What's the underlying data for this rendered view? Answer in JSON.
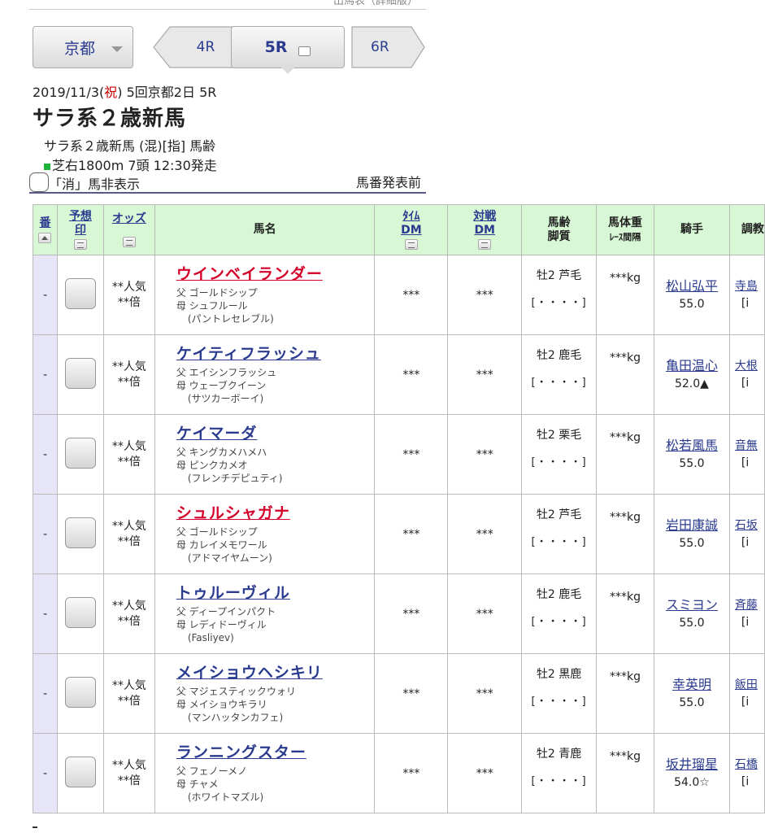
{
  "top_link": "出馬表（詳細版）",
  "nav": {
    "venue": "京都",
    "prev": "4R",
    "current": "5R",
    "next": "6R"
  },
  "race": {
    "date_pre": "2019/11/3(",
    "holiday": "祝",
    "date_post": ") 5回京都2日 5R",
    "title": "サラ系２歳新馬",
    "conditions": "サラ系２歳新馬 (混)[指] 馬齢",
    "course": "芝右1800m 7頭 12:30発走"
  },
  "filter": {
    "label": "「消」馬非表示",
    "status": "馬番発表前"
  },
  "headers": {
    "ban": "番",
    "yoso_1": "予想",
    "yoso_2": "印",
    "odds": "オッズ",
    "name": "馬名",
    "time_1": "ﾀｲﾑ",
    "time_2": "DM",
    "taisen_1": "対戦",
    "taisen_2": "DM",
    "age_1": "馬齢",
    "age_2": "脚質",
    "wt_1": "馬体重",
    "wt_2": "ﾚｰｽ間隔",
    "jockey": "騎手",
    "trainer": "調教"
  },
  "horses": [
    {
      "num": "-",
      "pop": "**人気",
      "odds": "**倍",
      "name": "ウインベイランダー",
      "red": true,
      "sire": "父 ゴールドシップ",
      "dam": "母 シュフルール",
      "bms": "(パントレセレブル)",
      "time_dm": "***",
      "taisen_dm": "***",
      "age": "牡2 芦毛",
      "legs": "[・・・・]",
      "weight": "***kg",
      "jockey": "松山弘平",
      "kin": "55.0",
      "trainer": "寺島",
      "trainer_sub": "[i"
    },
    {
      "num": "-",
      "pop": "**人気",
      "odds": "**倍",
      "name": "ケイティフラッシュ",
      "red": false,
      "sire": "父 エイシンフラッシュ",
      "dam": "母 ウェーブクイーン",
      "bms": "(サツカーボーイ)",
      "time_dm": "***",
      "taisen_dm": "***",
      "age": "牡2 鹿毛",
      "legs": "[・・・・]",
      "weight": "***kg",
      "jockey": "亀田温心",
      "kin": "52.0▲",
      "trainer": "大根",
      "trainer_sub": "[i"
    },
    {
      "num": "-",
      "pop": "**人気",
      "odds": "**倍",
      "name": "ケイマーダ",
      "red": false,
      "sire": "父 キングカメハメハ",
      "dam": "母 ピンクカメオ",
      "bms": "(フレンチデピュティ)",
      "time_dm": "***",
      "taisen_dm": "***",
      "age": "牡2 栗毛",
      "legs": "[・・・・]",
      "weight": "***kg",
      "jockey": "松若風馬",
      "kin": "55.0",
      "trainer": "音無",
      "trainer_sub": "[i"
    },
    {
      "num": "-",
      "pop": "**人気",
      "odds": "**倍",
      "name": "シュルシャガナ",
      "red": true,
      "sire": "父 ゴールドシップ",
      "dam": "母 カレイメモワール",
      "bms": "(アドマイヤムーン)",
      "time_dm": "***",
      "taisen_dm": "***",
      "age": "牡2 芦毛",
      "legs": "[・・・・]",
      "weight": "***kg",
      "jockey": "岩田康誠",
      "kin": "55.0",
      "trainer": "石坂",
      "trainer_sub": "[i"
    },
    {
      "num": "-",
      "pop": "**人気",
      "odds": "**倍",
      "name": "トゥルーヴィル",
      "red": false,
      "sire": "父 ディープインパクト",
      "dam": "母 レディドーヴィル",
      "bms": "(Fasliyev)",
      "time_dm": "***",
      "taisen_dm": "***",
      "age": "牡2 鹿毛",
      "legs": "[・・・・]",
      "weight": "***kg",
      "jockey": "スミヨン",
      "kin": "55.0",
      "trainer": "斉藤",
      "trainer_sub": "[i"
    },
    {
      "num": "-",
      "pop": "**人気",
      "odds": "**倍",
      "name": "メイショウヘシキリ",
      "red": false,
      "sire": "父 マジェスティックウォリ",
      "dam": "母 メイショウキラリ",
      "bms": "(マンハッタンカフェ)",
      "time_dm": "***",
      "taisen_dm": "***",
      "age": "牡2 黒鹿",
      "legs": "[・・・・]",
      "weight": "***kg",
      "jockey": "幸英明",
      "kin": "55.0",
      "trainer": "飯田",
      "trainer_sub": "[i"
    },
    {
      "num": "-",
      "pop": "**人気",
      "odds": "**倍",
      "name": "ランニングスター",
      "red": false,
      "sire": "父 フェノーメノ",
      "dam": "母 チャメ",
      "bms": "(ホワイトマズル)",
      "time_dm": "***",
      "taisen_dm": "***",
      "age": "牡2 青鹿",
      "legs": "[・・・・]",
      "weight": "***kg",
      "jockey": "坂井瑠星",
      "kin": "54.0☆",
      "trainer": "石橋",
      "trainer_sub": "[i"
    }
  ],
  "colors": {
    "header_bg": "#d7f7d5",
    "num_bg": "#e6e6f8",
    "link": "#2a3b8f",
    "red_name": "#d3002a",
    "holiday": "#cc0000",
    "turf": "#1cb33a"
  }
}
